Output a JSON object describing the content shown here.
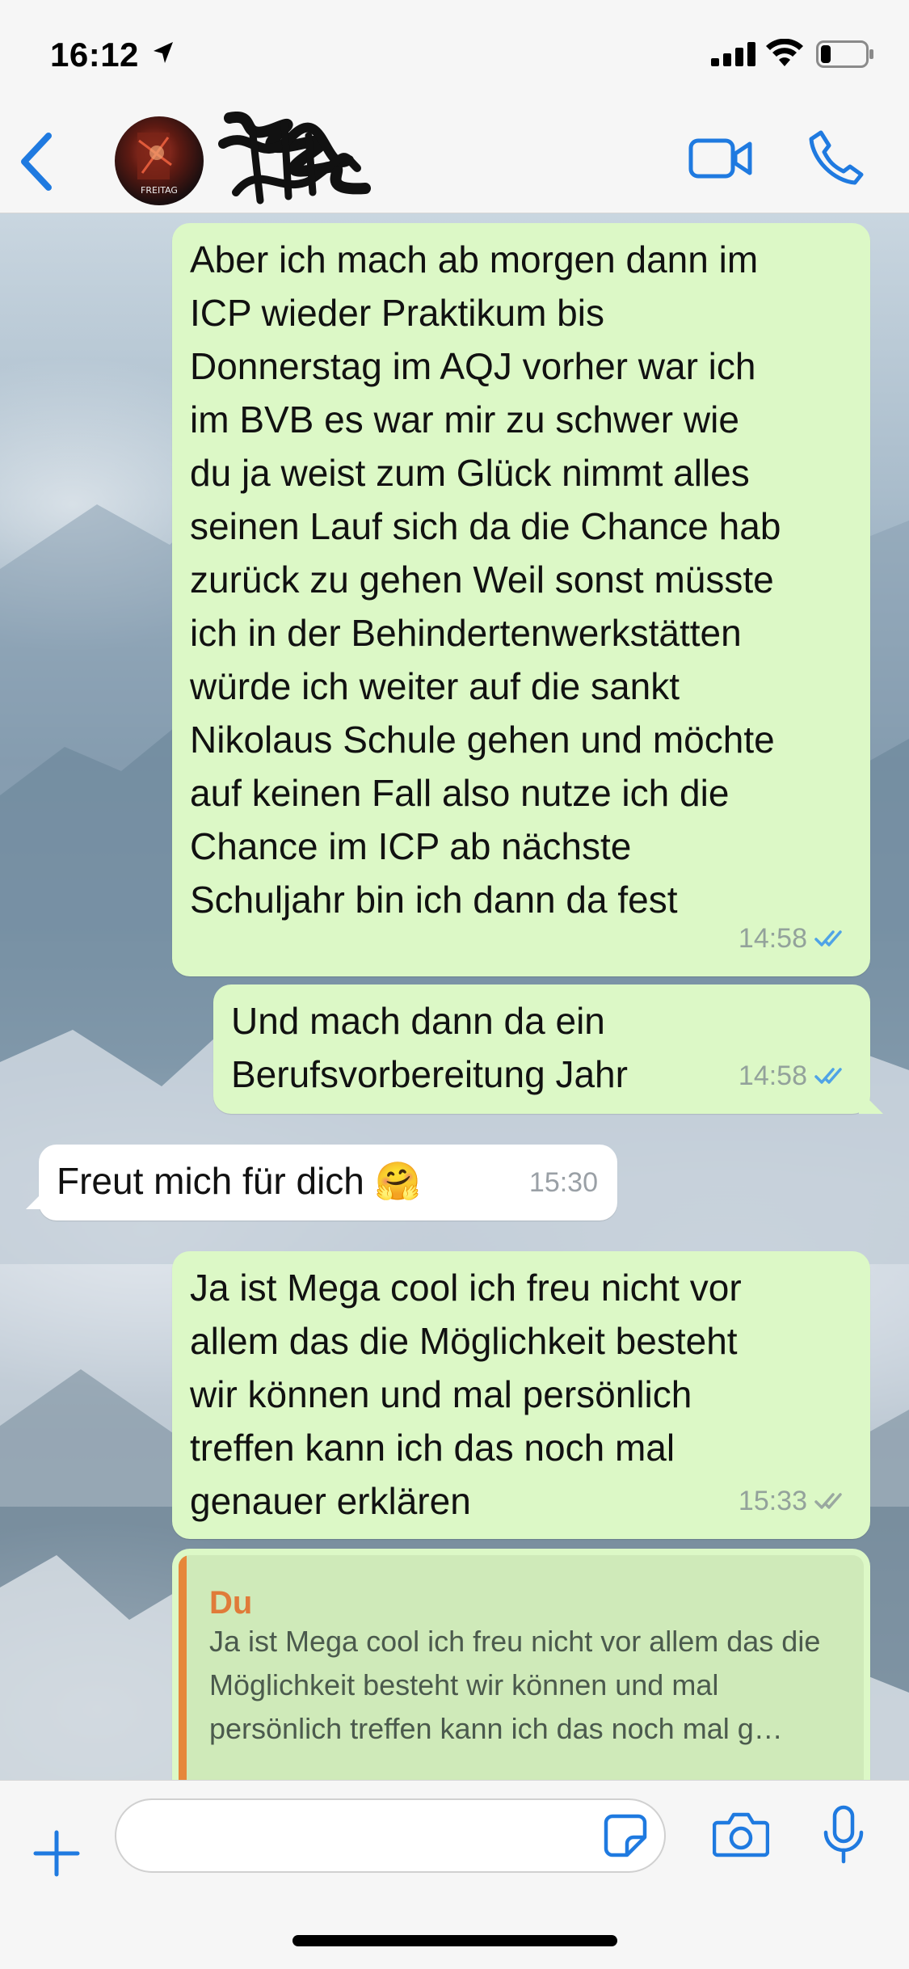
{
  "status_bar": {
    "time": "16:12"
  },
  "header": {
    "contact_name": "",
    "avatar_caption": "FREITAG"
  },
  "messages": [
    {
      "direction": "out",
      "text": "Aber ich mach ab morgen dann im\nICP wieder Praktikum bis\nDonnerstag im AQJ vorher war ich\nim BVB es war mir zu schwer wie\ndu ja weist zum Glück nimmt alles\nseinen Lauf sich da die Chance hab\nzurück zu gehen Weil sonst müsste\nich in der Behindertenwerkstätten\nwürde ich weiter auf die sankt\nNikolaus Schule gehen und möchte\nauf keinen Fall also nutze ich die\nChance im ICP ab nächste\nSchuljahr bin ich dann da fest",
      "time": "14:58",
      "status": "read"
    },
    {
      "direction": "out",
      "text": "Und mach dann da ein\nBerufsvorbereitung Jahr",
      "time": "14:58",
      "status": "read"
    },
    {
      "direction": "in",
      "text": "Freut mich für dich 🤗",
      "time": "15:30"
    },
    {
      "direction": "out",
      "text": "Ja ist Mega cool ich freu nicht vor\nallem das die Möglichkeit besteht\nwir können und mal persönlich\ntreffen kann ich das noch mal\ngenauer erklären",
      "time": "15:33",
      "status": "delivered"
    },
    {
      "direction": "out",
      "quote": {
        "author": "Du",
        "text": "Ja ist Mega cool ich freu nicht vor allem das die Möglichkeit besteht wir können und mal persönlich treffen kann ich das noch mal g…"
      }
    }
  ],
  "input": {
    "placeholder": ""
  },
  "colors": {
    "accent": "#1f7ae0",
    "outgoing_bubble": "#dcf8c6",
    "incoming_bubble": "#ffffff",
    "read_ticks": "#4fa3e6",
    "delivered_ticks": "#9aa8a0",
    "quote_author": "#e07b39"
  },
  "icons": [
    "back-chevron-icon",
    "location-arrow-icon",
    "signal-icon",
    "wifi-icon",
    "battery-icon",
    "video-call-icon",
    "phone-icon",
    "plus-icon",
    "sticker-icon",
    "camera-icon",
    "microphone-icon",
    "double-check-icon"
  ]
}
